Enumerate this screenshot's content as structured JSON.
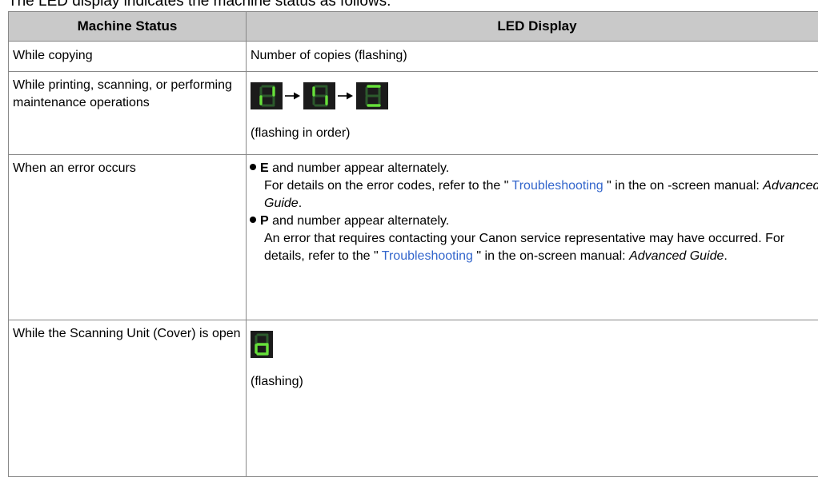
{
  "intro": "The LED display indicates the machine status as follows.",
  "headers": {
    "status": "Machine Status",
    "display": "LED Display"
  },
  "rows": {
    "copying": {
      "status": "While copying",
      "display": "Number of copies (flashing)"
    },
    "printing": {
      "status": "While printing, scanning, or performing maintenance operations",
      "caption": "(flashing in order)",
      "led_icons": [
        "led-segment-pattern-1-icon",
        "led-segment-pattern-2-icon",
        "led-segment-pattern-3-icon"
      ],
      "arrow_icon": "right-arrow-icon"
    },
    "error": {
      "status": "When an error occurs",
      "e": {
        "letter": "E",
        "text": " and number appear alternately.",
        "note_pre": "For details on the error codes, refer to the \" ",
        "link": "Troubleshooting",
        "note_mid": " \" in the on -screen manual: ",
        "guide": "Advanced Guide",
        "note_end": "."
      },
      "p": {
        "letter": "P",
        "text": " and number appear alternately.",
        "note_pre": "An error that requires contacting your Canon service representative may have occurred. For details, refer to the \" ",
        "link": "Troubleshooting",
        "note_mid": " \" in the on-screen manual: ",
        "guide": "Advanced Guide",
        "note_end": "."
      }
    },
    "cover": {
      "status": "While the Scanning Unit (Cover) is open",
      "caption": "(flashing)",
      "led_icons": [
        "led-segment-o-icon"
      ]
    }
  },
  "colors": {
    "header_bg": "#c9c9c9",
    "border": "#888888",
    "link": "#3366cc",
    "led_bg": "#1b1b1b",
    "led_on": "#66e03a",
    "led_off": "#2c5a2c"
  }
}
